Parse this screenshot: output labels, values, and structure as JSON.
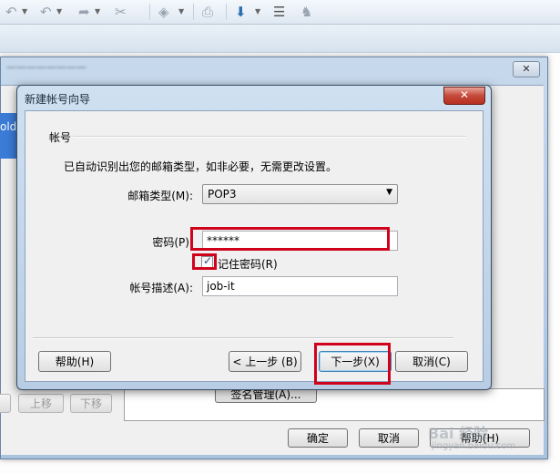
{
  "background": {
    "toolbar_icons": [
      "back-icon",
      "undo-icon",
      "redo-icon",
      "cut-icon",
      "tag-icon",
      "print-icon",
      "download-icon",
      "card-icon",
      "plugin-icon"
    ],
    "bg_window_close": "✕",
    "list_item_fragment": "old)",
    "buttons": {
      "move_up": "上移",
      "move_down": "下移",
      "signature_manage": "签名管理(A)...",
      "ok": "确定",
      "cancel": "取消",
      "help": "帮助(H)"
    },
    "watermark": "Bai 经验",
    "watermark_sub": "jingyan.baidu.com"
  },
  "dialog": {
    "title": "新建帐号向导",
    "close": "✕",
    "section_title": "帐号",
    "info": "已自动识别出您的邮箱类型，如非必要，无需更改设置。",
    "mailbox_type_label": "邮箱类型(M):",
    "mailbox_type_value": "POP3",
    "password_label": "密码(P):",
    "password_value": "******",
    "remember_password": "记住密码(R)",
    "remember_checked": true,
    "description_label": "帐号描述(A):",
    "description_value": "job-it",
    "buttons": {
      "help": "帮助(H)",
      "prev": "< 上一步 (B)",
      "next": "下一步(X)",
      "cancel": "取消(C)"
    }
  },
  "colors": {
    "highlight": "#d0021b",
    "dialog_frame": "#b8cde4"
  }
}
